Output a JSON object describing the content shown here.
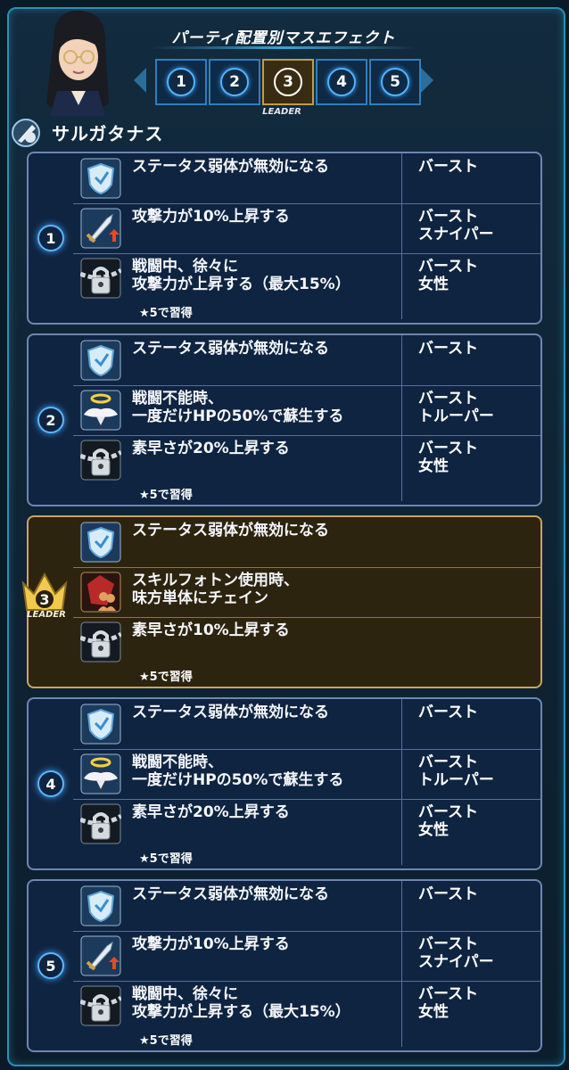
{
  "header": {
    "character_name": "サルガタナス",
    "party_title": "パーティ配置別マスエフェクト",
    "leader_tag": "LEADER",
    "slots": [
      "1",
      "2",
      "3",
      "4",
      "5"
    ],
    "active_slot": 3
  },
  "groups": [
    {
      "number": "1",
      "rows": [
        {
          "text1": "ステータス弱体が無効になる",
          "text2": "",
          "tag1": "バースト",
          "tag2": "",
          "learn": "",
          "icon": "shield-icon"
        },
        {
          "text1": "攻撃力が10%上昇する",
          "text2": "",
          "tag1": "バースト",
          "tag2": "スナイパー",
          "learn": "",
          "icon": "sword-up-icon"
        },
        {
          "text1": "戦闘中、徐々に",
          "text2": "攻撃力が上昇する（最大15%）",
          "tag1": "バースト",
          "tag2": "女性",
          "learn": "★5で習得",
          "icon": "lock-icon"
        }
      ]
    },
    {
      "number": "2",
      "rows": [
        {
          "text1": "ステータス弱体が無効になる",
          "text2": "",
          "tag1": "バースト",
          "tag2": "",
          "learn": "",
          "icon": "shield-icon"
        },
        {
          "text1": "戦闘不能時、",
          "text2": "一度だけHPの50%で蘇生する",
          "tag1": "バースト",
          "tag2": "トルーパー",
          "learn": "",
          "icon": "angel-wings-icon"
        },
        {
          "text1": "素早さが20%上昇する",
          "text2": "",
          "tag1": "バースト",
          "tag2": "女性",
          "learn": "★5で習得",
          "icon": "lock-icon"
        }
      ]
    },
    {
      "number": "3",
      "leader": true,
      "leader_label": "LEADER",
      "rows": [
        {
          "text1": "ステータス弱体が無効になる",
          "text2": "",
          "tag1": "",
          "tag2": "",
          "learn": "",
          "icon": "shield-icon"
        },
        {
          "text1": "スキルフォトン使用時、",
          "text2": "味方単体にチェイン",
          "tag1": "",
          "tag2": "",
          "learn": "",
          "icon": "chain-party-icon"
        },
        {
          "text1": "素早さが10%上昇する",
          "text2": "",
          "tag1": "",
          "tag2": "",
          "learn": "★5で習得",
          "icon": "lock-icon"
        }
      ]
    },
    {
      "number": "4",
      "rows": [
        {
          "text1": "ステータス弱体が無効になる",
          "text2": "",
          "tag1": "バースト",
          "tag2": "",
          "learn": "",
          "icon": "shield-icon"
        },
        {
          "text1": "戦闘不能時、",
          "text2": "一度だけHPの50%で蘇生する",
          "tag1": "バースト",
          "tag2": "トルーパー",
          "learn": "",
          "icon": "angel-wings-icon"
        },
        {
          "text1": "素早さが20%上昇する",
          "text2": "",
          "tag1": "バースト",
          "tag2": "女性",
          "learn": "★5で習得",
          "icon": "lock-icon"
        }
      ]
    },
    {
      "number": "5",
      "rows": [
        {
          "text1": "ステータス弱体が無効になる",
          "text2": "",
          "tag1": "バースト",
          "tag2": "",
          "learn": "",
          "icon": "shield-icon"
        },
        {
          "text1": "攻撃力が10%上昇する",
          "text2": "",
          "tag1": "バースト",
          "tag2": "スナイパー",
          "learn": "",
          "icon": "sword-up-icon"
        },
        {
          "text1": "戦闘中、徐々に",
          "text2": "攻撃力が上昇する（最大15%）",
          "tag1": "バースト",
          "tag2": "女性",
          "learn": "★5で習得",
          "icon": "lock-icon"
        }
      ]
    }
  ]
}
